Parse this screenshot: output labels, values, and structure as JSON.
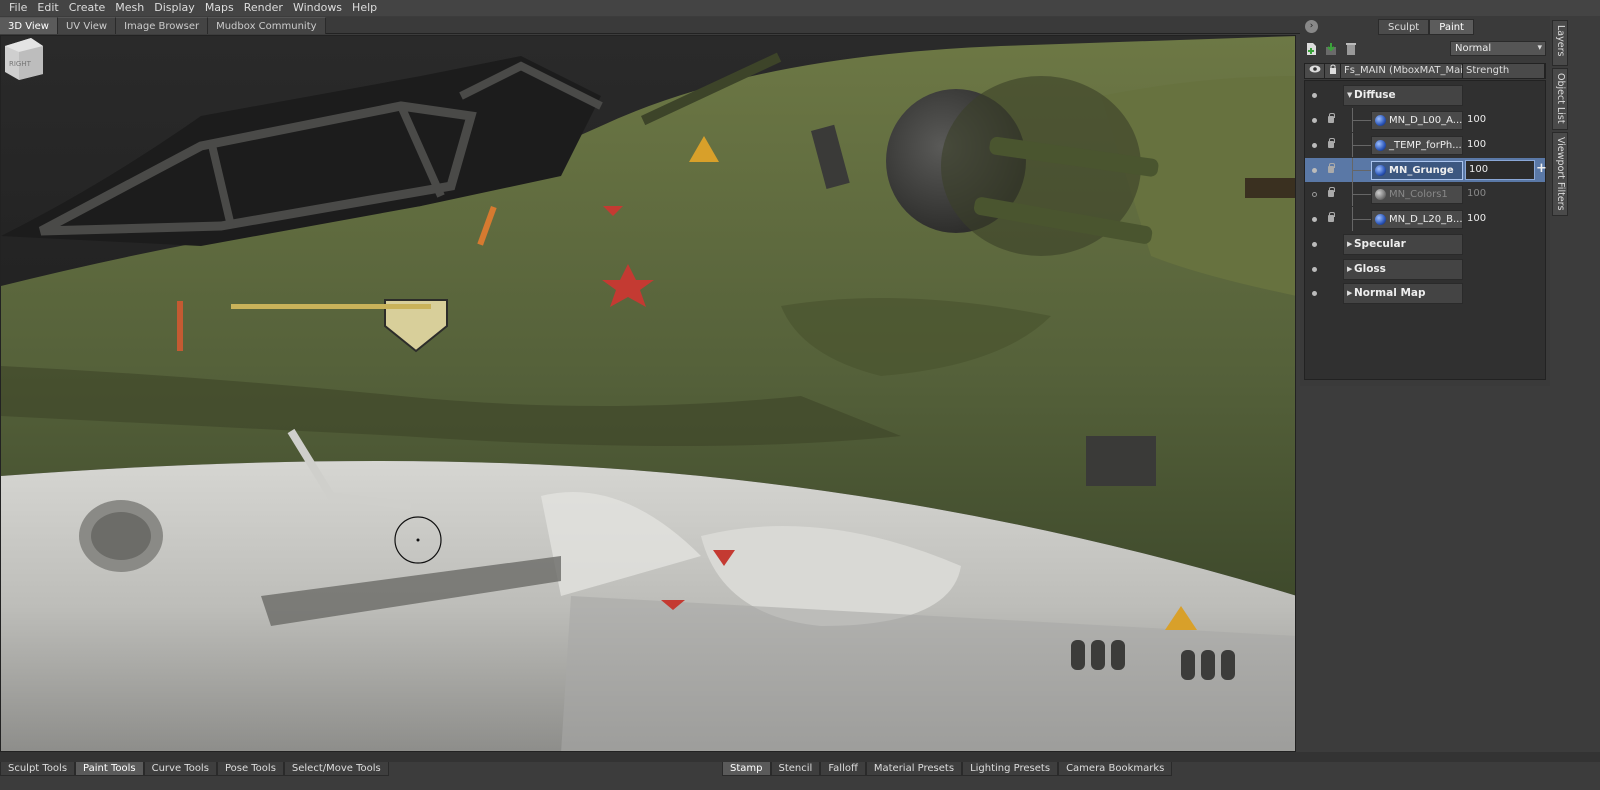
{
  "menu": [
    "File",
    "Edit",
    "Create",
    "Mesh",
    "Display",
    "Maps",
    "Render",
    "Windows",
    "Help"
  ],
  "viewport_tabs": [
    {
      "label": "3D View",
      "active": true
    },
    {
      "label": "UV View",
      "active": false
    },
    {
      "label": "Image Browser",
      "active": false
    },
    {
      "label": "Mudbox Community",
      "active": false
    }
  ],
  "viewcube": {
    "face_label": "RIGHT"
  },
  "panel": {
    "collapse_icon": "›",
    "mode_buttons": [
      {
        "label": "Sculpt",
        "active": false
      },
      {
        "label": "Paint",
        "active": true
      }
    ],
    "toolbar_icons": [
      "new-layer-icon",
      "import-layer-icon",
      "delete-layer-icon"
    ],
    "blend_mode": "Normal",
    "header": {
      "material": "Fs_MAIN (MboxMAT_Main",
      "strength_label": "Strength"
    },
    "groups": [
      {
        "label": "Diffuse",
        "expanded": true
      },
      {
        "label": "Specular",
        "expanded": false
      },
      {
        "label": "Gloss",
        "expanded": false
      },
      {
        "label": "Normal Map",
        "expanded": false
      }
    ],
    "layers": [
      {
        "name": "MN_D_L00_A...",
        "strength": "100",
        "visible": true,
        "selected": false,
        "dim": false,
        "swatch": "blue"
      },
      {
        "name": "_TEMP_forPh...",
        "strength": "100",
        "visible": true,
        "selected": false,
        "dim": false,
        "swatch": "blue"
      },
      {
        "name": "MN_Grunge",
        "strength": "100",
        "visible": true,
        "selected": true,
        "dim": false,
        "swatch": "blue"
      },
      {
        "name": "MN_Colors1",
        "strength": "100",
        "visible": false,
        "selected": false,
        "dim": true,
        "swatch": "gray"
      },
      {
        "name": "MN_D_L20_B...",
        "strength": "100",
        "visible": true,
        "selected": false,
        "dim": false,
        "swatch": "blue"
      }
    ]
  },
  "side_tabs": [
    "Layers",
    "Object List",
    "Viewport Filters"
  ],
  "bottom_left_tabs": [
    {
      "label": "Sculpt Tools",
      "active": false
    },
    {
      "label": "Paint Tools",
      "active": true
    },
    {
      "label": "Curve Tools",
      "active": false
    },
    {
      "label": "Pose Tools",
      "active": false
    },
    {
      "label": "Select/Move Tools",
      "active": false
    }
  ],
  "bottom_right_tabs": [
    {
      "label": "Stamp",
      "active": true
    },
    {
      "label": "Stencil",
      "active": false
    },
    {
      "label": "Falloff",
      "active": false
    },
    {
      "label": "Material Presets",
      "active": false
    },
    {
      "label": "Lighting Presets",
      "active": false
    },
    {
      "label": "Camera Bookmarks",
      "active": false
    }
  ],
  "colors": {
    "hull_green": "#5f6b3a",
    "hull_white": "#c9c9c5",
    "selection_blue": "#5a78a6",
    "marking_red": "#c43a32",
    "warning_yellow": "#d8a02a"
  }
}
